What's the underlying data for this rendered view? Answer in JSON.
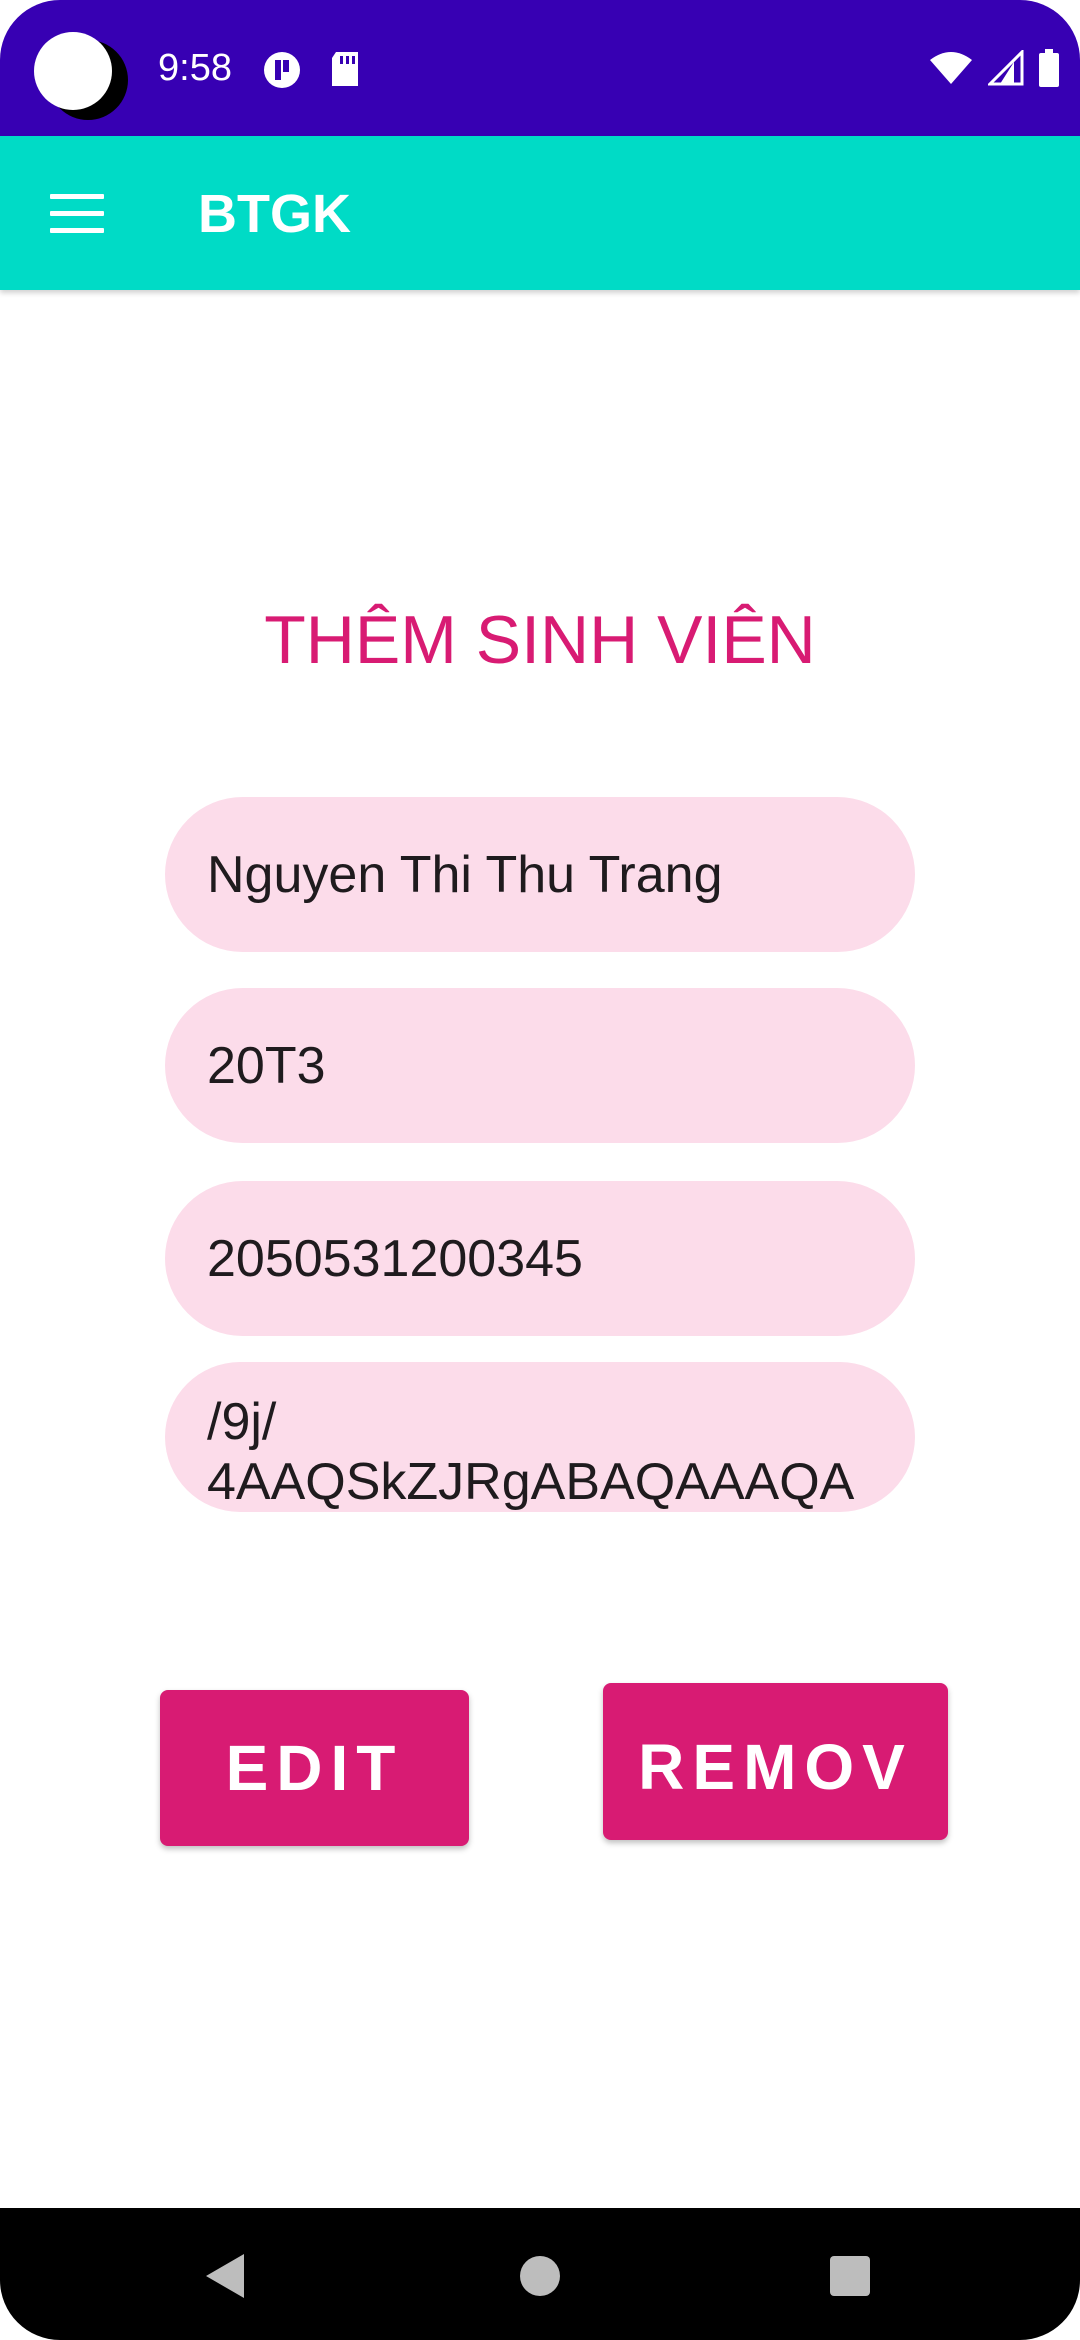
{
  "status_bar": {
    "time": "9:58",
    "icons_left": [
      "notification-badge-icon",
      "sd-card-icon"
    ],
    "icons_right": [
      "wifi-icon",
      "cell-signal-icon",
      "battery-icon"
    ]
  },
  "toolbar": {
    "title": "BTGK",
    "menu_icon": "hamburger-menu-icon",
    "background_color": "#00dbc6"
  },
  "main": {
    "title": "THÊM SINH VIÊN",
    "fields": {
      "name": "Nguyen Thi Thu Trang",
      "class": "20T3",
      "student_id": "2050531200345",
      "image_line1": "/9j/",
      "image_line2": "4AAQSkZJRgABAQAAAQA"
    },
    "buttons": {
      "edit": "EDIT",
      "remove": "REMOVE"
    },
    "accent_color": "#d81b73",
    "field_color": "#fcdcea"
  },
  "status_bar_color": "#3700b3",
  "nav_bar": {
    "icons": [
      "back-icon",
      "home-icon",
      "recents-icon"
    ]
  }
}
